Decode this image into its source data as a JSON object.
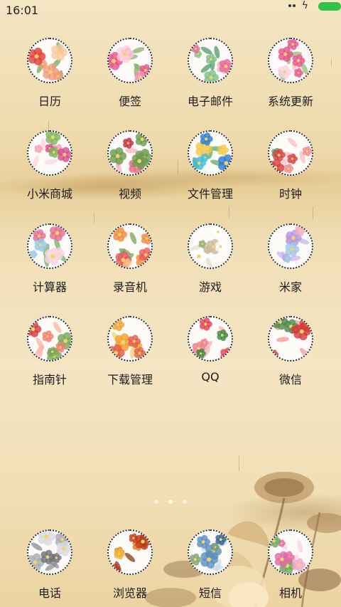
{
  "status_bar": {
    "time": "16:01",
    "icons": [
      "signal-dots-icon",
      "charging-bolt-icon",
      "battery-icon"
    ],
    "battery_color": "#33c14a"
  },
  "apps": [
    {
      "label": "日历",
      "icon": "calendar-flower-icon"
    },
    {
      "label": "便签",
      "icon": "notes-flower-icon"
    },
    {
      "label": "电子邮件",
      "icon": "email-flower-icon"
    },
    {
      "label": "系统更新",
      "icon": "update-flower-icon"
    },
    {
      "label": "小米商城",
      "icon": "mall-flower-icon"
    },
    {
      "label": "视频",
      "icon": "video-flower-icon"
    },
    {
      "label": "文件管理",
      "icon": "files-flower-icon"
    },
    {
      "label": "时钟",
      "icon": "clock-flower-icon"
    },
    {
      "label": "计算器",
      "icon": "calculator-flower-icon"
    },
    {
      "label": "录音机",
      "icon": "recorder-flower-icon"
    },
    {
      "label": "游戏",
      "icon": "game-flower-icon"
    },
    {
      "label": "米家",
      "icon": "mijia-flower-icon"
    },
    {
      "label": "指南针",
      "icon": "compass-flower-icon"
    },
    {
      "label": "下载管理",
      "icon": "downloads-flower-icon"
    },
    {
      "label": "QQ",
      "icon": "qq-flower-icon"
    },
    {
      "label": "微信",
      "icon": "wechat-flower-icon"
    }
  ],
  "dock": [
    {
      "label": "电话",
      "icon": "phone-flower-icon"
    },
    {
      "label": "浏览器",
      "icon": "browser-flower-icon"
    },
    {
      "label": "短信",
      "icon": "messages-flower-icon"
    },
    {
      "label": "相机",
      "icon": "camera-flower-icon"
    }
  ],
  "page_indicator": {
    "pages": 3,
    "current": 2
  }
}
